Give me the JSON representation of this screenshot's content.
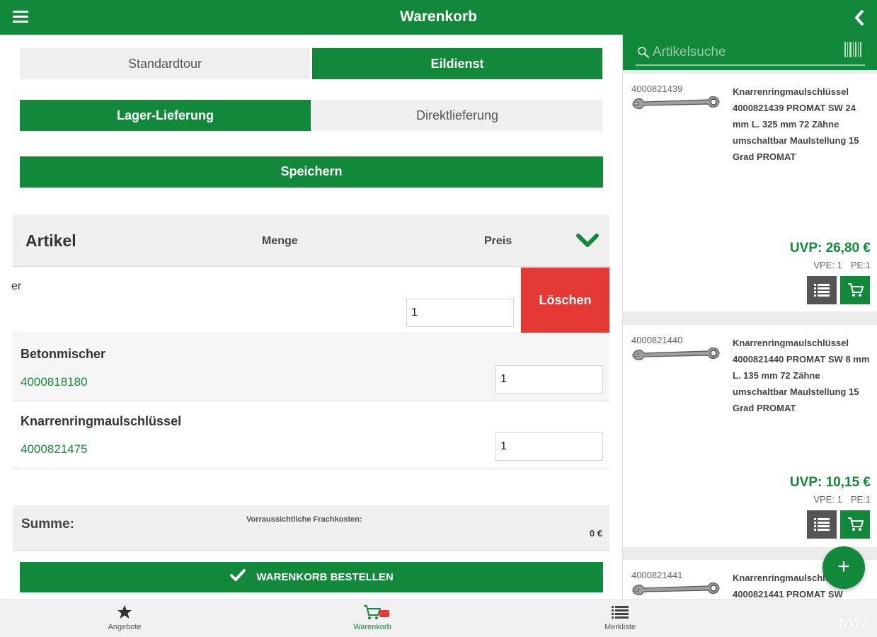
{
  "header": {
    "title": "Warenkorb"
  },
  "tour": {
    "standard": "Standardtour",
    "express": "Eildienst"
  },
  "delivery": {
    "warehouse": "Lager-Lieferung",
    "direct": "Direktlieferung"
  },
  "save_label": "Speichern",
  "cart_header": {
    "article": "Artikel",
    "quantity": "Menge",
    "price": "Preis"
  },
  "cart_items": [
    {
      "name_fragment": "er",
      "qty": "1",
      "delete_label": "Löschen"
    },
    {
      "name": "Betonmischer",
      "number": "4000818180",
      "qty": "1"
    },
    {
      "name": "Knarrenringmaulschlüssel",
      "number": "4000821475",
      "qty": "1"
    }
  ],
  "summary": {
    "label": "Summe:",
    "freight_label": "Vorraussichtliche Frachkosten:",
    "value": "0 €"
  },
  "order_label": "WARENKORB BESTELLEN",
  "search": {
    "placeholder": "Artikelsuche"
  },
  "products": [
    {
      "number": "4000821439",
      "description": "Knarrenringmaulschlüssel 4000821439 PROMAT SW 24 mm L. 325 mm 72 Zähne umschaltbar Maulstellung 15 Grad PROMAT",
      "price": "UVP: 26,80 €",
      "vpe": "VPE: 1",
      "pe": "PE:1"
    },
    {
      "number": "4000821440",
      "description": "Knarrenringmaulschlüssel 4000821440 PROMAT SW 8 mm L. 135 mm 72 Zähne umschaltbar Maulstellung 15 Grad PROMAT",
      "price": "UVP: 10,15 €",
      "vpe": "VPE: 1",
      "pe": "PE:1"
    },
    {
      "number": "4000821441",
      "description": "Knarrenringmaulschlüssel 4000821441 PROMAT SW"
    }
  ],
  "fab_label": "+",
  "nav": {
    "offers": "Angebote",
    "cart": "Warenkorb",
    "wishlist": "Merkliste"
  },
  "brand": "NWZ",
  "colors": {
    "green": "#12893a",
    "delete_red": "#e53935"
  }
}
